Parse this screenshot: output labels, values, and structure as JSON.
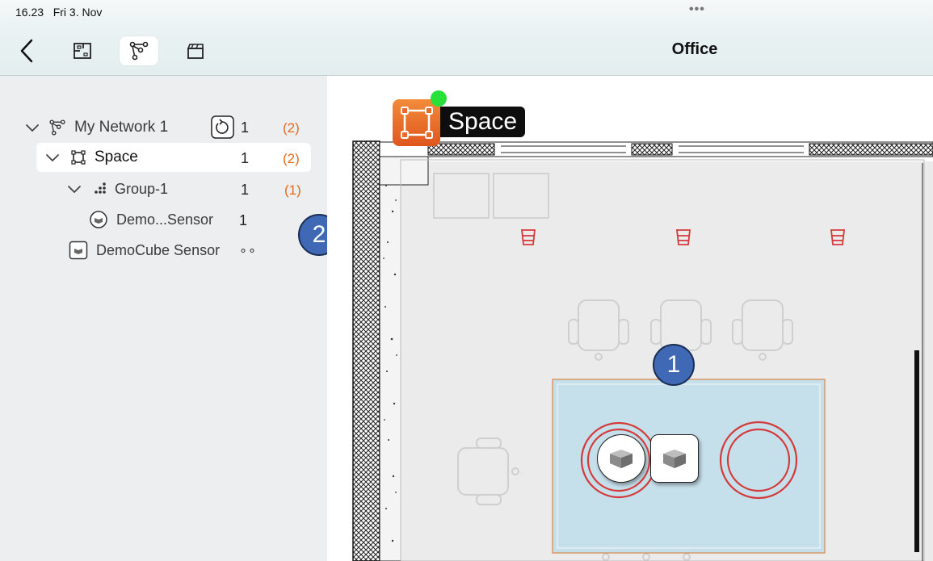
{
  "status": {
    "time": "16.23",
    "date": "Fri 3. Nov",
    "dots": "•••"
  },
  "header": {
    "title": "Office"
  },
  "tree": [
    {
      "label": "My Network 1",
      "count": "1",
      "warn": "(2)"
    },
    {
      "label": "Space",
      "count": "1",
      "warn": "(2)"
    },
    {
      "label": "Group-1",
      "count": "1",
      "warn": "(1)"
    },
    {
      "label": "Demo...Sensor",
      "count": "1"
    },
    {
      "label": "DemoCube Sensor",
      "status": "∘∘"
    }
  ],
  "badges": {
    "one": "1",
    "two": "2"
  },
  "canvas": {
    "space_label": "Space"
  },
  "colors": {
    "accent_orange": "#e46a1c",
    "badge_blue": "#3f68b5",
    "online_green": "#27e038",
    "zone_fill": "#c5dfeb"
  }
}
